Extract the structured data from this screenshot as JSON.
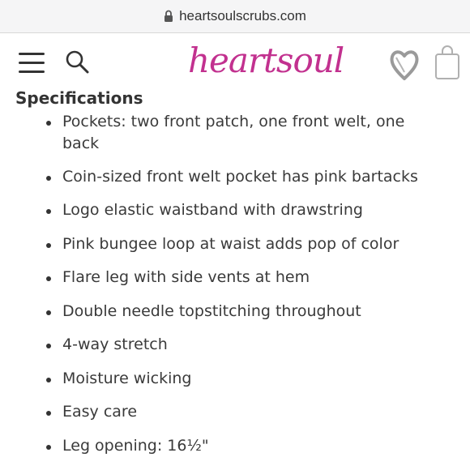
{
  "browser": {
    "url": "heartsoulscrubs.com"
  },
  "header": {
    "logo_text": "heartsoul",
    "icons": [
      "menu-icon",
      "search-icon",
      "heart-icon",
      "shopping-bag-icon"
    ],
    "brand_color": "#c2318f"
  },
  "specs": {
    "title": "Specifications",
    "items": [
      "Pockets: two front patch, one front welt, one back",
      "Coin-sized front welt pocket has pink bartacks",
      "Logo elastic waistband with drawstring",
      "Pink bungee loop at waist adds pop of color",
      "Flare leg with side vents at hem",
      "Double needle topstitching throughout",
      "4-way stretch",
      "Moisture wicking",
      "Easy care",
      "Leg opening: 16½\""
    ]
  }
}
